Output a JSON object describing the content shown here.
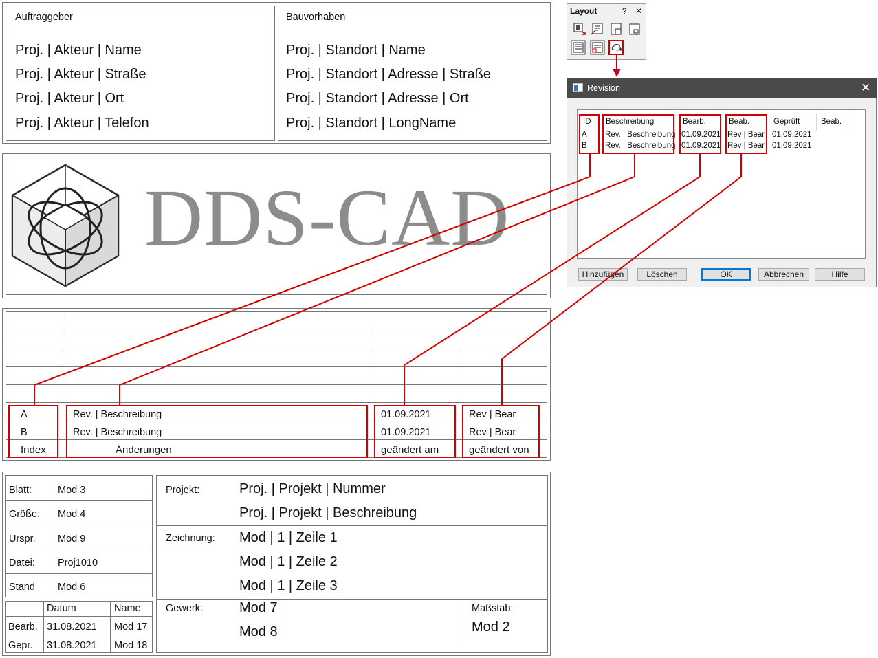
{
  "header": {
    "client_title": "Auftraggeber",
    "client_lines": [
      "Proj. | Akteur | Name",
      "Proj. | Akteur | Straße",
      "Proj. | Akteur | Ort",
      "Proj. | Akteur | Telefon"
    ],
    "project_title": "Bauvorhaben",
    "project_lines": [
      "Proj. | Standort | Name",
      "Proj. | Standort | Adresse | Straße",
      "Proj. | Standort | Adresse | Ort",
      "Proj. | Standort | LongName"
    ]
  },
  "logo": {
    "text": "DDS-CAD"
  },
  "revision_block": {
    "rows": [
      {
        "index": "A",
        "desc": "Rev. | Beschreibung",
        "date": "01.09.2021",
        "by": "Rev | Bear"
      },
      {
        "index": "B",
        "desc": "Rev. | Beschreibung",
        "date": "01.09.2021",
        "by": "Rev | Bear"
      }
    ],
    "footer": {
      "index": "Index",
      "desc": "Änderungen",
      "date": "geändert am",
      "by": "geändert von"
    }
  },
  "title_block": {
    "fields": [
      {
        "label": "Blatt:",
        "value": "Mod 3"
      },
      {
        "label": "Größe:",
        "value": "Mod 4"
      },
      {
        "label": "Urspr.",
        "value": "Mod 9"
      },
      {
        "label": "Datei:",
        "value": "Proj1010"
      },
      {
        "label": "Stand",
        "value": "Mod 6"
      }
    ],
    "sig_header": {
      "date": "Datum",
      "name": "Name"
    },
    "sig_rows": [
      {
        "label": "Bearb.",
        "date": "31.08.2021",
        "name": "Mod 17"
      },
      {
        "label": "Gepr.",
        "date": "31.08.2021",
        "name": "Mod 18"
      }
    ],
    "projekt_label": "Projekt:",
    "projekt_lines": [
      "Proj. | Projekt | Nummer",
      "Proj. | Projekt | Beschreibung"
    ],
    "zeichnung_label": "Zeichnung:",
    "zeichnung_lines": [
      "Mod | 1 | Zeile 1",
      "Mod | 1 | Zeile 2",
      "Mod | 1 | Zeile 3"
    ],
    "gewerk_label": "Gewerk:",
    "gewerk_lines": [
      "Mod 7",
      "Mod 8"
    ],
    "massstab_label": "Maßstab:",
    "massstab_value": "Mod 2"
  },
  "layout_toolbar": {
    "title": "Layout",
    "help": "?",
    "close": "✕",
    "icons": [
      "insert-object-icon",
      "insert-field-icon",
      "page-layout-icon",
      "frame-icon",
      "legend-icon",
      "revision-table-icon",
      "revision-cloud-icon"
    ]
  },
  "revision_dialog": {
    "title": "Revision",
    "close": "✕",
    "columns": [
      "ID",
      "Beschreibung",
      "Bearb.",
      "Beab.",
      "Geprüft",
      "Beab."
    ],
    "rows": [
      {
        "id": "A",
        "desc": "Rev. | Beschreibung",
        "bearb": "01.09.2021",
        "beab": "Rev | Bear",
        "geprueft": "01.09.2021",
        "beab2": ""
      },
      {
        "id": "B",
        "desc": "Rev. | Beschreibung",
        "bearb": "01.09.2021",
        "beab": "Rev | Bear",
        "geprueft": "01.09.2021",
        "beab2": ""
      }
    ],
    "buttons": {
      "add": "Hinzufügen",
      "delete": "Löschen",
      "ok": "OK",
      "cancel": "Abbrechen",
      "help": "Hilfe"
    }
  },
  "colors": {
    "annotation_red": "#d40000",
    "arrow_red": "#c0002a",
    "frame_gray": "#777777",
    "logo_gray": "#8c8c8c"
  }
}
